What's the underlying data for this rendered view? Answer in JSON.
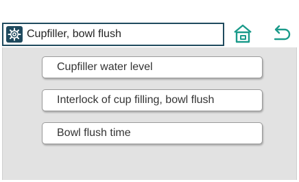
{
  "header": {
    "title": "Cupfiller, bowl flush",
    "settings_icon": "gear-icon",
    "home_icon": "home-icon",
    "back_icon": "back-arrow-icon"
  },
  "menu": {
    "items": [
      {
        "label": "Cupfiller water level"
      },
      {
        "label": "Interlock of cup filling, bowl flush"
      },
      {
        "label": "Bowl flush time"
      }
    ]
  },
  "colors": {
    "accent": "#1f4a5e",
    "icon_teal": "#1a9a8a",
    "panel_bg": "#e2e2e2"
  }
}
